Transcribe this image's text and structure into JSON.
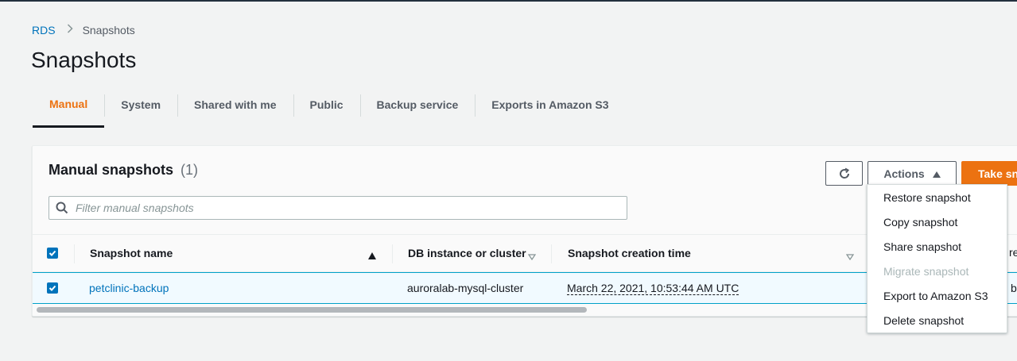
{
  "breadcrumb": {
    "root": "RDS",
    "current": "Snapshots"
  },
  "page_title": "Snapshots",
  "tabs": [
    {
      "label": "Manual"
    },
    {
      "label": "System"
    },
    {
      "label": "Shared with me"
    },
    {
      "label": "Public"
    },
    {
      "label": "Backup service"
    },
    {
      "label": "Exports in Amazon S3"
    }
  ],
  "panel": {
    "title": "Manual snapshots",
    "count": "(1)",
    "filter_placeholder": "Filter manual snapshots",
    "refresh_icon": "refresh-icon",
    "actions_label": "Actions",
    "take_label": "Take snapshot"
  },
  "table": {
    "columns": [
      "Snapshot name",
      "DB instance or cluster",
      "Snapshot creation time"
    ],
    "rows": [
      {
        "name": "petclinic-backup",
        "instance": "auroralab-mysql-cluster",
        "created": "March 22, 2021, 10:53:44 AM UTC"
      }
    ],
    "peek_header": "res",
    "peek_cell": "ble"
  },
  "actions_menu": [
    {
      "label": "Restore snapshot",
      "enabled": true
    },
    {
      "label": "Copy snapshot",
      "enabled": true
    },
    {
      "label": "Share snapshot",
      "enabled": true
    },
    {
      "label": "Migrate snapshot",
      "enabled": false
    },
    {
      "label": "Export to Amazon S3",
      "enabled": true
    },
    {
      "label": "Delete snapshot",
      "enabled": true
    }
  ],
  "colors": {
    "accent": "#ec7211",
    "link": "#0073bb",
    "selected_row": "#f1faff"
  }
}
